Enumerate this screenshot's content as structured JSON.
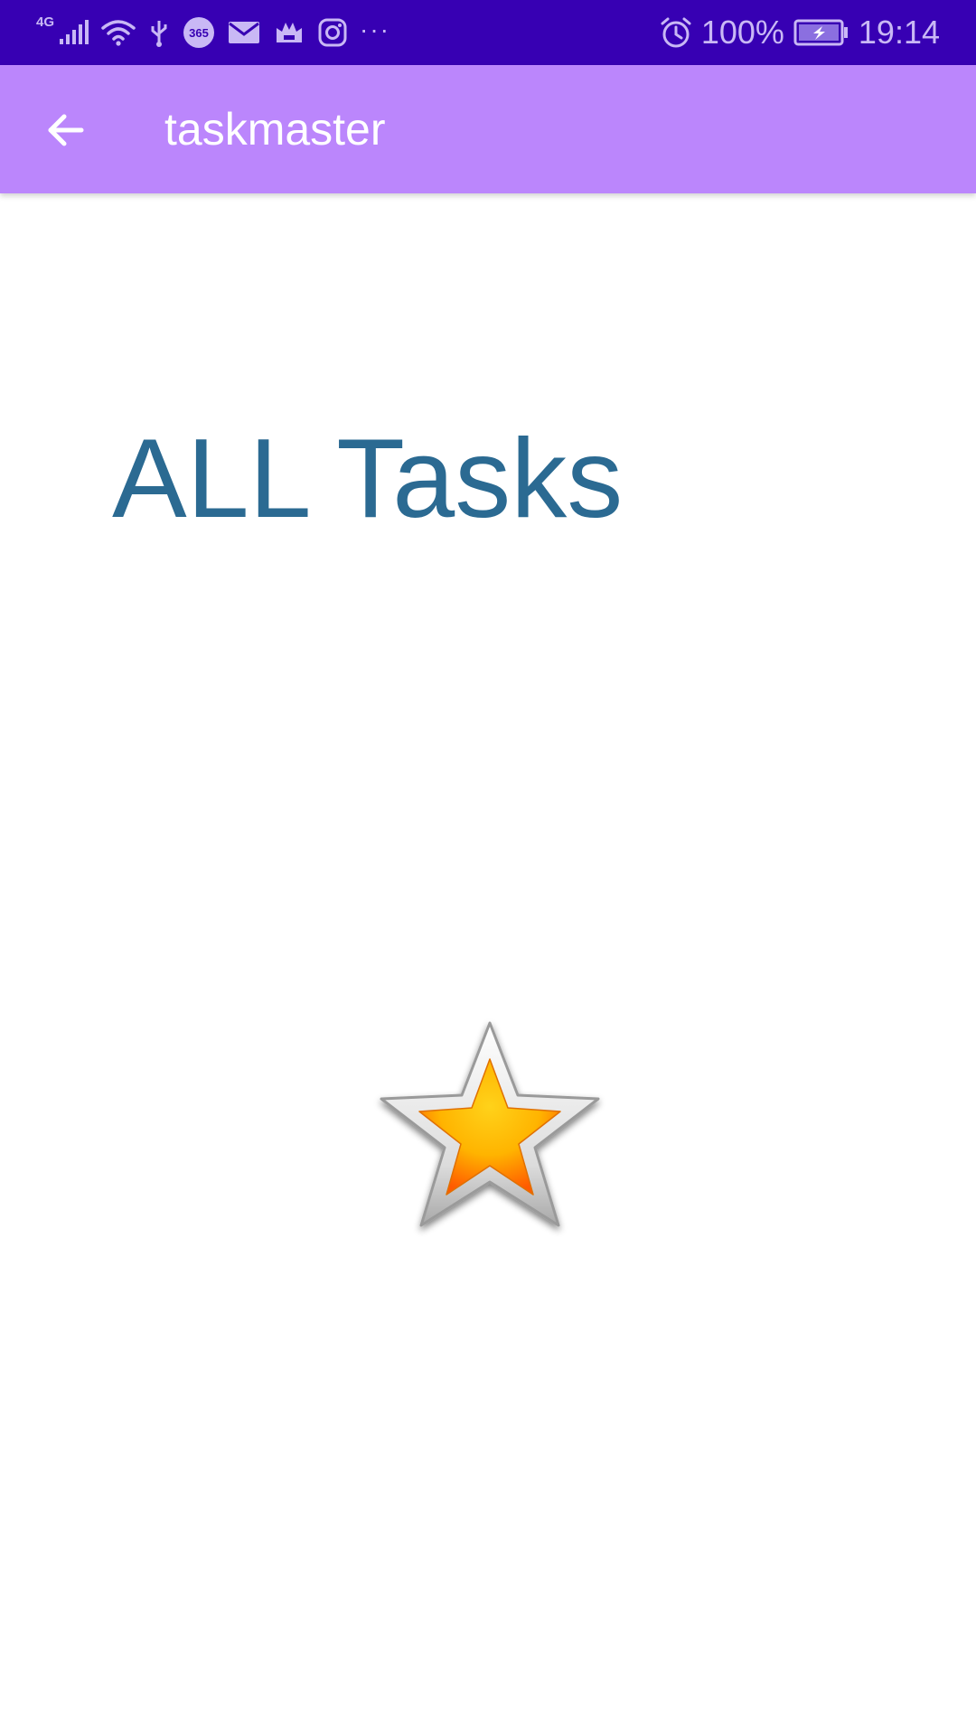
{
  "status_bar": {
    "network_type": "4G",
    "notification_badge": "365",
    "battery_percent": "100%",
    "time": "19:14",
    "more_indicator": "···",
    "icons": [
      "signal-icon",
      "wifi-icon",
      "usb-icon",
      "app-365-icon",
      "mail-icon",
      "game-icon",
      "instagram-icon",
      "alarm-icon",
      "battery-charging-icon"
    ]
  },
  "app_bar": {
    "title": "taskmaster",
    "back_icon": "arrow-back-icon"
  },
  "main": {
    "heading": "ALL Tasks",
    "image_icon": "star-icon"
  },
  "colors": {
    "status_bar": "#3700b3",
    "app_bar": "#bb86fc",
    "heading": "#2b6a92",
    "background": "#ffffff"
  }
}
